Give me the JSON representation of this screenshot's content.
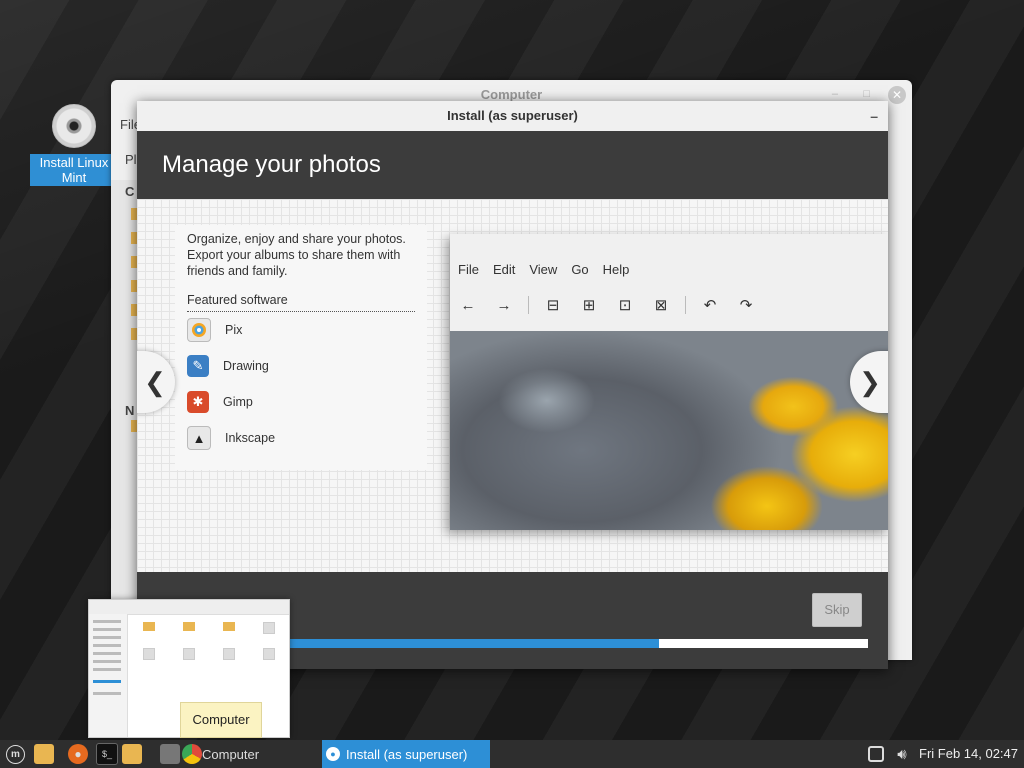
{
  "desktop": {
    "icon_label": "Install Linux Mint"
  },
  "background_window": {
    "title": "Computer",
    "menu_peek": "File",
    "sub_peek": "Pl",
    "side_peek_1": "C",
    "side_peek_2": "N"
  },
  "installer": {
    "window_title": "Install (as superuser)",
    "minimize_glyph": "–",
    "slide_title": "Manage your photos",
    "description": "Organize, enjoy and share your photos. Export your albums to share them with friends and family.",
    "featured_heading": "Featured software",
    "apps": [
      {
        "name": "Pix",
        "icon": "pix-icon",
        "color": "#e8e8e8"
      },
      {
        "name": "Drawing",
        "icon": "drawing-icon",
        "color": "#3b7fc4"
      },
      {
        "name": "Gimp",
        "icon": "gimp-icon",
        "color": "#d94b2b"
      },
      {
        "name": "Inkscape",
        "icon": "inkscape-icon",
        "color": "#e8e8e8"
      }
    ],
    "screenshot_menu": [
      "File",
      "Edit",
      "View",
      "Go",
      "Help"
    ],
    "nav_prev": "❮",
    "nav_next": "❯",
    "skip_label": "Skip",
    "progress_fraction": 0.64,
    "accent_color": "#2d8fd6"
  },
  "preview": {
    "tooltip": "Computer"
  },
  "taskbar": {
    "tasks": [
      {
        "label": "Computer",
        "active": false
      },
      {
        "label": "Install (as superuser)",
        "active": true
      }
    ],
    "clock": "Fri Feb 14, 02:47"
  }
}
